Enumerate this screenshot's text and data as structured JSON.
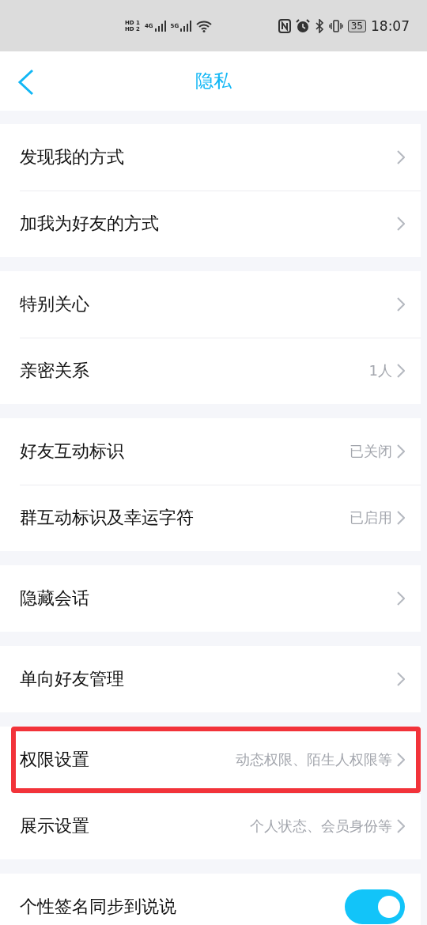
{
  "status_bar": {
    "sims": [
      {
        "hd": "HD",
        "slot": "1",
        "net": "4G"
      },
      {
        "hd": "HD",
        "slot": "2",
        "net": "5G"
      }
    ],
    "battery": "35",
    "time": "18:07"
  },
  "nav": {
    "title": "隐私"
  },
  "groups": [
    {
      "rows": [
        {
          "kind": "link",
          "label": "发现我的方式",
          "highlighted": false
        },
        {
          "kind": "link",
          "label": "加我为好友的方式",
          "highlighted": false
        }
      ]
    },
    {
      "rows": [
        {
          "kind": "link",
          "label": "特别关心",
          "highlighted": false
        },
        {
          "kind": "link",
          "label": "亲密关系",
          "value": "1人",
          "highlighted": false
        }
      ]
    },
    {
      "rows": [
        {
          "kind": "link",
          "label": "好友互动标识",
          "value": "已关闭",
          "highlighted": false
        },
        {
          "kind": "link",
          "label": "群互动标识及幸运字符",
          "value": "已启用",
          "highlighted": false
        }
      ]
    },
    {
      "rows": [
        {
          "kind": "link",
          "label": "隐藏会话",
          "highlighted": false
        }
      ]
    },
    {
      "rows": [
        {
          "kind": "link",
          "label": "单向好友管理",
          "highlighted": false
        }
      ]
    },
    {
      "rows": [
        {
          "kind": "link",
          "label": "权限设置",
          "value": "动态权限、陌生人权限等",
          "highlighted": true
        },
        {
          "kind": "link",
          "label": "展示设置",
          "value": "个人状态、会员身份等",
          "highlighted": false
        }
      ]
    },
    {
      "rows": [
        {
          "kind": "toggle",
          "label": "个性签名同步到说说",
          "on": true,
          "highlighted": false
        }
      ]
    }
  ]
}
